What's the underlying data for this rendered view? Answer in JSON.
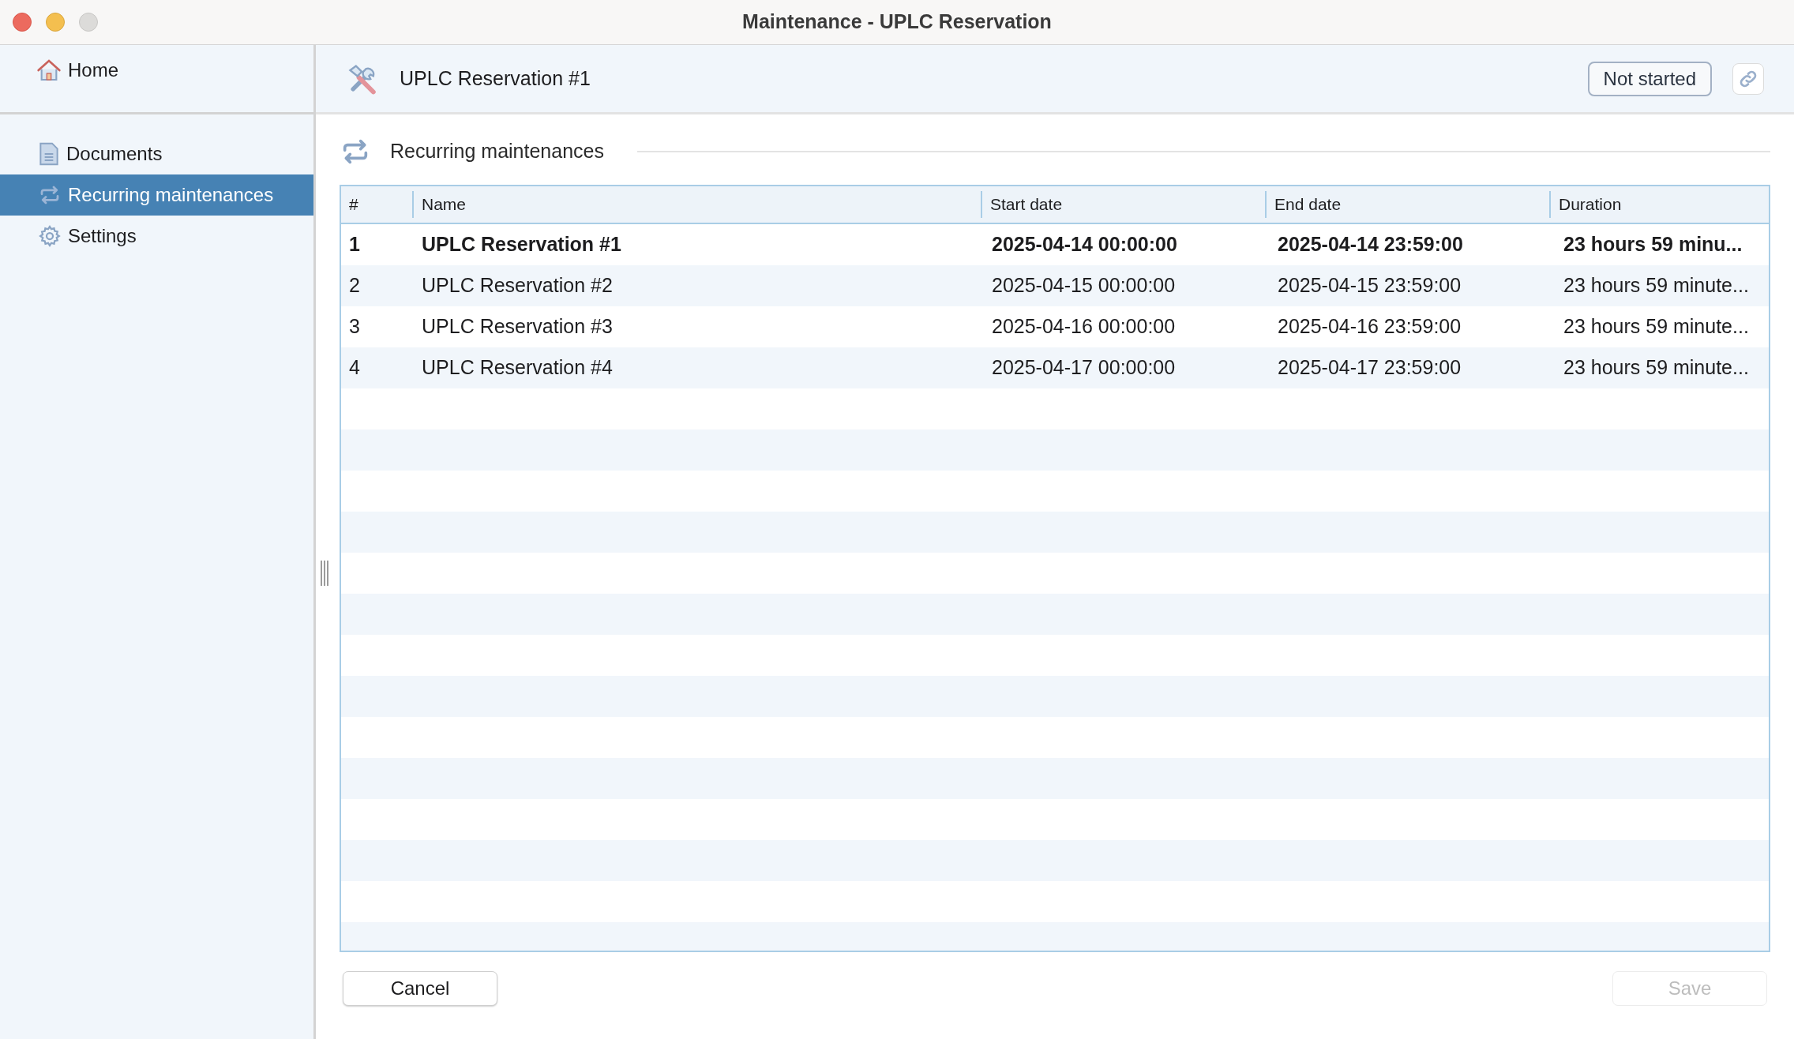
{
  "window": {
    "title": "Maintenance - UPLC Reservation"
  },
  "sidebar": {
    "home": {
      "label": "Home"
    },
    "items": [
      {
        "label": "Documents",
        "kind": "document",
        "selected": false
      },
      {
        "label": "Recurring maintenances",
        "kind": "recurring",
        "selected": true
      },
      {
        "label": "Settings",
        "kind": "settings",
        "selected": false
      }
    ]
  },
  "header": {
    "title": "UPLC Reservation #1",
    "status": "Not started"
  },
  "section": {
    "title": "Recurring maintenances"
  },
  "table": {
    "columns": [
      "#",
      "Name",
      "Start date",
      "End date",
      "Duration"
    ],
    "rows": [
      {
        "cells": [
          "1",
          "UPLC Reservation #1",
          "2025-04-14 00:00:00",
          "2025-04-14 23:59:00",
          "23 hours 59 minu..."
        ],
        "current": true
      },
      {
        "cells": [
          "2",
          "UPLC Reservation #2",
          "2025-04-15 00:00:00",
          "2025-04-15 23:59:00",
          "23 hours 59 minute..."
        ],
        "current": false
      },
      {
        "cells": [
          "3",
          "UPLC Reservation #3",
          "2025-04-16 00:00:00",
          "2025-04-16 23:59:00",
          "23 hours 59 minute..."
        ],
        "current": false
      },
      {
        "cells": [
          "4",
          "UPLC Reservation #4",
          "2025-04-17 00:00:00",
          "2025-04-17 23:59:00",
          "23 hours 59 minute..."
        ],
        "current": false
      }
    ]
  },
  "buttons": [
    {
      "label": "Cancel",
      "disabled": false
    },
    {
      "label": "Save",
      "disabled": true
    }
  ]
}
